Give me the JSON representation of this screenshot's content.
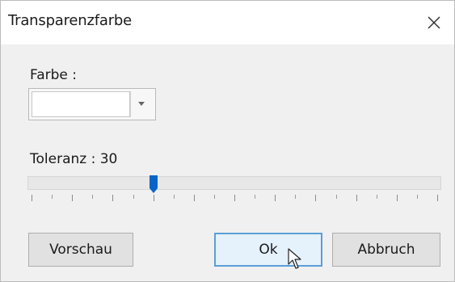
{
  "window": {
    "title": "Transparenzfarbe"
  },
  "color": {
    "label": "Farbe :",
    "swatch_color": "#ffffff"
  },
  "tolerance": {
    "label": "Toleranz : 30",
    "value": 30,
    "min": 0,
    "max": 100
  },
  "buttons": {
    "preview": "Vorschau",
    "ok": "Ok",
    "cancel": "Abbruch"
  },
  "icons": {
    "close": "close-icon",
    "dropdown": "chevron-down-icon",
    "cursor": "mouse-pointer-icon"
  },
  "colors": {
    "accent": "#0a64c8",
    "focus_border": "#5a9fd6"
  }
}
